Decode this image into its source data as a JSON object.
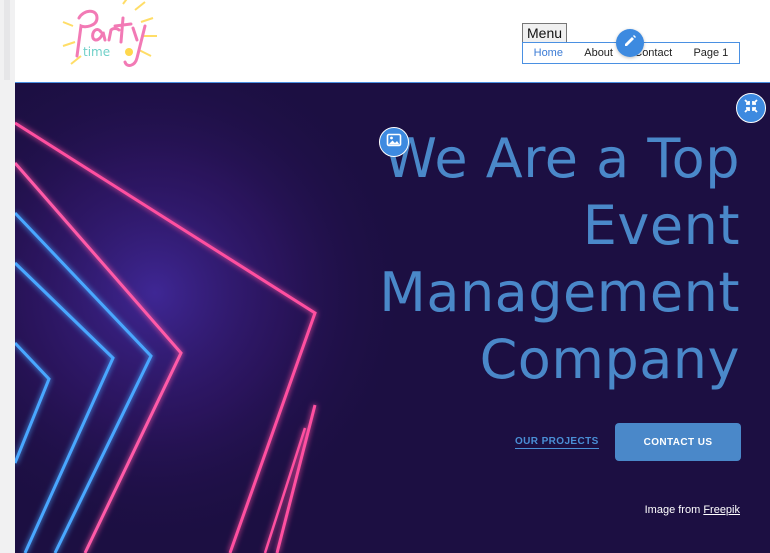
{
  "header": {
    "logo": {
      "text": "Party time",
      "colors": {
        "pink": "#f27ab5",
        "yellow": "#ffd84d",
        "teal": "#6fd0c8"
      }
    },
    "menu_label": "Menu",
    "nav": [
      {
        "label": "Home",
        "active": true
      },
      {
        "label": "About",
        "active": false
      },
      {
        "label": "Contact",
        "active": false
      },
      {
        "label": "Page 1",
        "active": false
      }
    ],
    "edit_icon": "pencil-icon"
  },
  "hero": {
    "headline_lines": [
      "We Are a Top",
      "Event",
      "Management",
      "Company"
    ],
    "secondary_link": "OUR PROJECTS",
    "primary_button": "CONTACT US",
    "credit_prefix": "Image from",
    "credit_link": "Freepik",
    "collapse_icon": "collapse-arrows-icon",
    "image_icon": "image-icon",
    "colors": {
      "background": "#1c0f42",
      "headline": "#4a88c9",
      "neon_pink": "#ff4fa0",
      "neon_blue": "#4aa7ff",
      "button": "#4a88c9",
      "accent": "#3d8ae0"
    }
  }
}
